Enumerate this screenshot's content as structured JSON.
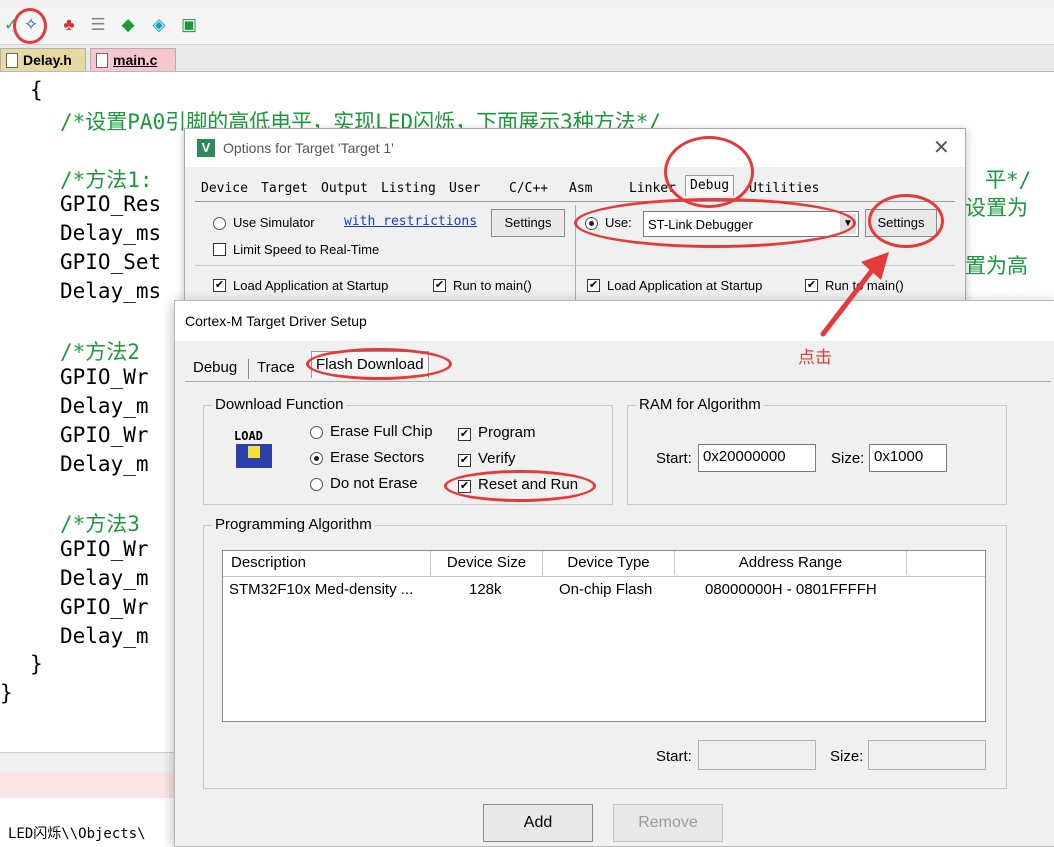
{
  "editor": {
    "file_tabs": [
      "Delay.h",
      "main.c"
    ],
    "code_lines": [
      "{",
      "/*设置PA0引脚的高低电平，实现LED闪烁，下面展示3种方法*/",
      "/*方法1:",
      "GPIO_Res",
      "Delay_ms",
      "GPIO_Set",
      "Delay_ms",
      "/*方法2",
      "GPIO_Wr",
      "Delay_m",
      "GPIO_Wr",
      "Delay_m",
      "/*方法3",
      "GPIO_Wr",
      "Delay_m",
      "GPIO_Wr",
      "Delay_m",
      "}",
      "}"
    ],
    "right_fragments": [
      "平*/",
      "设置为",
      "置为高"
    ],
    "output_text": "LED闪烁\\\\Objects\\"
  },
  "options_window": {
    "title": "Options for Target 'Target 1'",
    "tabs": [
      "Device",
      "Target",
      "Output",
      "Listing",
      "User",
      "C/C++",
      "Asm",
      "Linker",
      "Debug",
      "Utilities"
    ],
    "use_simulator": "Use Simulator",
    "with_restrictions": "with restrictions",
    "settings": "Settings",
    "limit_speed": "Limit Speed to Real-Time",
    "use": "Use:",
    "debugger": "ST-Link Debugger",
    "load_app": "Load Application at Startup",
    "run_to_main": "Run to main()"
  },
  "annotation": {
    "click": "点击"
  },
  "driver_dialog": {
    "title": "Cortex-M Target Driver Setup",
    "tabs": [
      "Debug",
      "Trace",
      "Flash Download"
    ],
    "download_function": {
      "label": "Download Function",
      "load_icon_text": "LOAD",
      "erase_full": "Erase Full Chip",
      "erase_sectors": "Erase Sectors",
      "do_not_erase": "Do not Erase",
      "program": "Program",
      "verify": "Verify",
      "reset_run": "Reset and Run"
    },
    "ram": {
      "label": "RAM for Algorithm",
      "start_label": "Start:",
      "start_value": "0x20000000",
      "size_label": "Size:",
      "size_value": "0x1000"
    },
    "algorithm": {
      "label": "Programming Algorithm",
      "columns": [
        "Description",
        "Device Size",
        "Device Type",
        "Address Range"
      ],
      "rows": [
        [
          "STM32F10x Med-density ...",
          "128k",
          "On-chip Flash",
          "08000000H - 0801FFFFH"
        ]
      ],
      "start_label": "Start:",
      "size_label": "Size:"
    },
    "add": "Add",
    "remove": "Remove"
  },
  "colors": {
    "annotation_red": "#e5393a",
    "comment_green": "#1a9a3a"
  }
}
